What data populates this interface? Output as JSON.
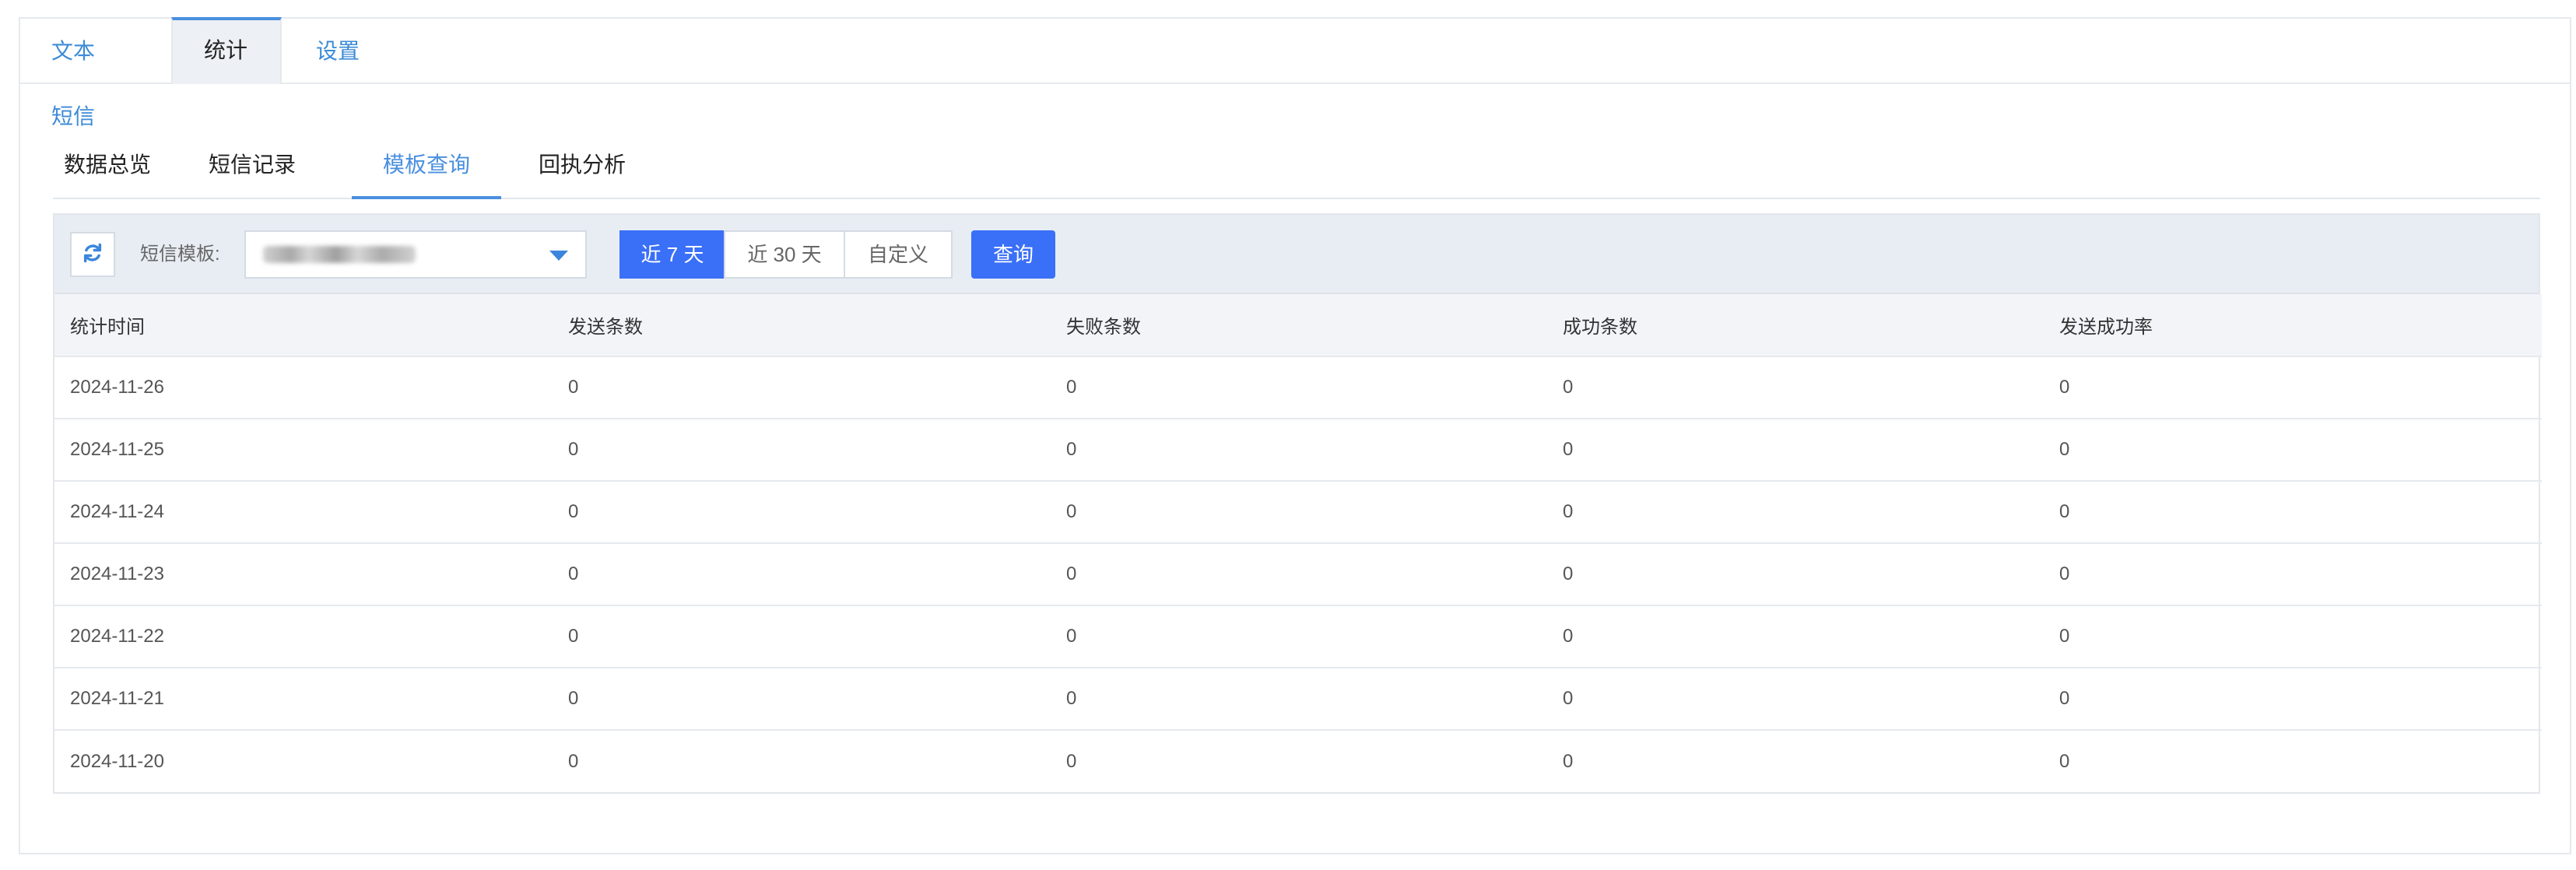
{
  "top_tabs": [
    {
      "label": "文本短信"
    },
    {
      "label": "统计"
    },
    {
      "label": "设置"
    }
  ],
  "sub_tabs": [
    {
      "label": "数据总览"
    },
    {
      "label": "短信记录"
    },
    {
      "label": "模板查询"
    },
    {
      "label": "回执分析"
    }
  ],
  "toolbar": {
    "refresh_icon": "refresh-icon",
    "template_label": "短信模板:",
    "range_options": [
      "近 7 天",
      "近 30 天",
      "自定义"
    ],
    "selected_range": "近 7 天",
    "query_label": "查询"
  },
  "colors": {
    "accent": "#3a6ff7",
    "link": "#3c8bd6",
    "toolbar_bg": "#e8edf4"
  },
  "table": {
    "columns": [
      "统计时间",
      "发送条数",
      "失败条数",
      "成功条数",
      "发送成功率"
    ],
    "rows": [
      [
        "2024-11-26",
        "0",
        "0",
        "0",
        "0"
      ],
      [
        "2024-11-25",
        "0",
        "0",
        "0",
        "0"
      ],
      [
        "2024-11-24",
        "0",
        "0",
        "0",
        "0"
      ],
      [
        "2024-11-23",
        "0",
        "0",
        "0",
        "0"
      ],
      [
        "2024-11-22",
        "0",
        "0",
        "0",
        "0"
      ],
      [
        "2024-11-21",
        "0",
        "0",
        "0",
        "0"
      ],
      [
        "2024-11-20",
        "0",
        "0",
        "0",
        "0"
      ]
    ]
  }
}
